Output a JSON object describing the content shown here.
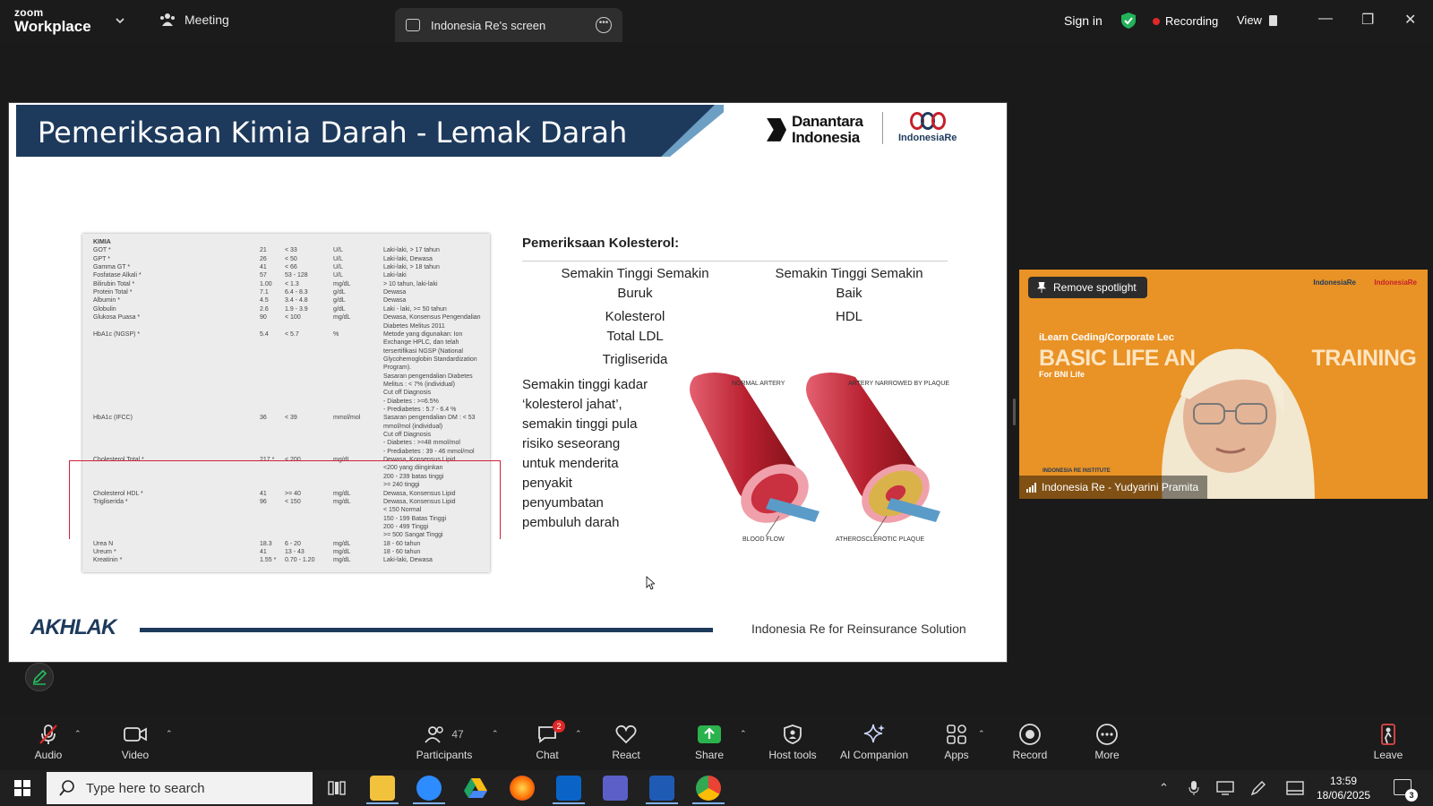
{
  "app": {
    "brand_top": "zoom",
    "brand_bottom": "Workplace"
  },
  "titlebar": {
    "meeting_tab": "Meeting",
    "screen_tab": "Indonesia Re's screen",
    "sign_in": "Sign in",
    "recording": "Recording",
    "view": "View"
  },
  "slide": {
    "title": "Pemeriksaan Kimia Darah - Lemak Darah",
    "logo1": "Danantara Indonesia",
    "logo2": "IndonesiaRe",
    "lab_rows": [
      [
        "KIMIA",
        "",
        "",
        "",
        ""
      ],
      [
        "GOT *",
        "21",
        "< 33",
        "U/L",
        "Laki-laki, > 17 tahun"
      ],
      [
        "GPT *",
        "26",
        "< 50",
        "U/L",
        "Laki-laki, Dewasa"
      ],
      [
        "Gamma GT *",
        "41",
        "< 66",
        "U/L",
        "Laki-laki, > 18 tahun"
      ],
      [
        "Fosfatase Alkali *",
        "57",
        "53 - 128",
        "U/L",
        "Laki-laki"
      ],
      [
        "Bilirubin Total *",
        "1.00",
        "< 1.3",
        "mg/dL",
        "> 10 tahun, laki-laki"
      ],
      [
        "Protein Total *",
        "7.1",
        "6.4 - 8.3",
        "g/dL",
        "Dewasa"
      ],
      [
        "Albumin *",
        "4.5",
        "3.4 - 4.8",
        "g/dL",
        "Dewasa"
      ],
      [
        "Globulin",
        "2.6",
        "1.9 - 3.9",
        "g/dL",
        "Laki - laki, >= 50 tahun"
      ],
      [
        "Glukosa Puasa *",
        "90",
        "< 100",
        "mg/dL",
        "Dewasa, Konsensus Pengendalian"
      ],
      [
        "",
        "",
        "",
        "",
        "Diabetes Melitus 2011"
      ],
      [
        "HbA1c (NGSP) *",
        "5.4",
        "< 5.7",
        "%",
        "Metode yang digunakan: Ion"
      ],
      [
        "",
        "",
        "",
        "",
        "Exchange HPLC, dan telah"
      ],
      [
        "",
        "",
        "",
        "",
        "tersertifikasi NGSP (National"
      ],
      [
        "",
        "",
        "",
        "",
        "Glycohemoglobin Standardization"
      ],
      [
        "",
        "",
        "",
        "",
        "Program)."
      ],
      [
        "",
        "",
        "",
        "",
        "Sasaran pengendalian Diabetes"
      ],
      [
        "",
        "",
        "",
        "",
        "Melitus : < 7% (individual)"
      ],
      [
        "",
        "",
        "",
        "",
        "Cut off Diagnosis"
      ],
      [
        "",
        "",
        "",
        "",
        "- Diabetes : >=6.5%"
      ],
      [
        "",
        "",
        "",
        "",
        "- Prediabetes : 5.7 - 6.4 %"
      ],
      [
        "HbA1c (IFCC)",
        "36",
        "< 39",
        "mmol/mol",
        "Sasaran pengendalian DM : < 53"
      ],
      [
        "",
        "",
        "",
        "",
        "mmol/mol (individual)"
      ],
      [
        "",
        "",
        "",
        "",
        "Cut off Diagnosis"
      ],
      [
        "",
        "",
        "",
        "",
        "- Diabetes : >=48 mmol/mol"
      ],
      [
        "",
        "",
        "",
        "",
        "- Prediabetes : 39 - 46 mmol/mol"
      ],
      [
        "Cholesterol Total *",
        "217 *",
        "< 200",
        "mg/dL",
        "Dewasa, Konsensus Lipid"
      ],
      [
        "",
        "",
        "",
        "",
        "<200 yang diinginkan"
      ],
      [
        "",
        "",
        "",
        "",
        "200 - 239 batas tinggi"
      ],
      [
        "",
        "",
        "",
        "",
        ">= 240 tinggi"
      ],
      [
        "Cholesterol HDL *",
        "41",
        ">= 40",
        "mg/dL",
        "Dewasa, Konsensus Lipid"
      ],
      [
        "Trigliserida *",
        "96",
        "< 150",
        "mg/dL",
        "Dewasa, Konsensus Lipid"
      ],
      [
        "",
        "",
        "",
        "",
        "< 150 Normal"
      ],
      [
        "",
        "",
        "",
        "",
        "150 - 199 Batas Tinggi"
      ],
      [
        "",
        "",
        "",
        "",
        "200 - 499 Tinggi"
      ],
      [
        "",
        "",
        "",
        "",
        ">= 500 Sangat Tinggi"
      ],
      [
        "Urea N",
        "18.3",
        "6 - 20",
        "mg/dL",
        "18 - 60 tahun"
      ],
      [
        "Ureum *",
        "41",
        "13 - 43",
        "mg/dL",
        "18 - 60 tahun"
      ],
      [
        "Kreatinin *",
        "1.55 *",
        "0.70 - 1.20",
        "mg/dL",
        "Laki-laki, Dewasa"
      ]
    ],
    "kolesterol_title": "Pemeriksaan Kolesterol:",
    "col_left": {
      "head1": "Semakin Tinggi Semakin",
      "head2": "Buruk",
      "i1": "Kolesterol",
      "i2": "Total LDL",
      "i3": "Trigliserida"
    },
    "col_right": {
      "head1": "Semakin Tinggi Semakin",
      "head2": "Baik",
      "i1": "HDL"
    },
    "desc": [
      "Semakin tinggi kadar",
      "‘kolesterol jahat’,",
      "semakin tinggi pula",
      "risiko seseorang",
      "untuk menderita",
      "penyakit",
      "penyumbatan",
      "pembuluh darah"
    ],
    "artery": {
      "normal": "NORMAL ARTERY",
      "narrowed": "ARTERY NARROWED BY PLAQUE",
      "flow": "BLOOD FLOW",
      "plaque": "ATHEROSCLEROTIC PLAQUE"
    },
    "footer_left": "AKHLAK",
    "footer_right": "Indonesia Re for Reinsurance Solution"
  },
  "participant": {
    "spotlight_btn": "Remove spotlight",
    "banner_top": "iLearn Ceding/Corporate Lec",
    "banner_big": "BASIC LIFE AN",
    "banner_big2": "TRAINING",
    "banner_sub": "For BNI Life",
    "logo_a": "IndonesiaRe",
    "logo_b": "IndonesiaRe",
    "institute": "INDONESIA RE INSTITUTE",
    "name": "Indonesia Re - Yudyarini Pramita"
  },
  "toolbar": {
    "audio": "Audio",
    "video": "Video",
    "participants": "Participants",
    "participants_count": "47",
    "chat": "Chat",
    "chat_badge": "2",
    "react": "React",
    "share": "Share",
    "host_tools": "Host tools",
    "ai_companion": "AI Companion",
    "apps": "Apps",
    "record": "Record",
    "more": "More",
    "leave": "Leave"
  },
  "taskbar": {
    "search_placeholder": "Type here to search",
    "time": "13:59",
    "date": "18/06/2025",
    "notif": "3"
  },
  "colors": {
    "brand_navy": "#1d3a5c",
    "highlight_red": "#d2203a",
    "tile_orange": "#e99225",
    "share_green": "#2bb24c"
  }
}
